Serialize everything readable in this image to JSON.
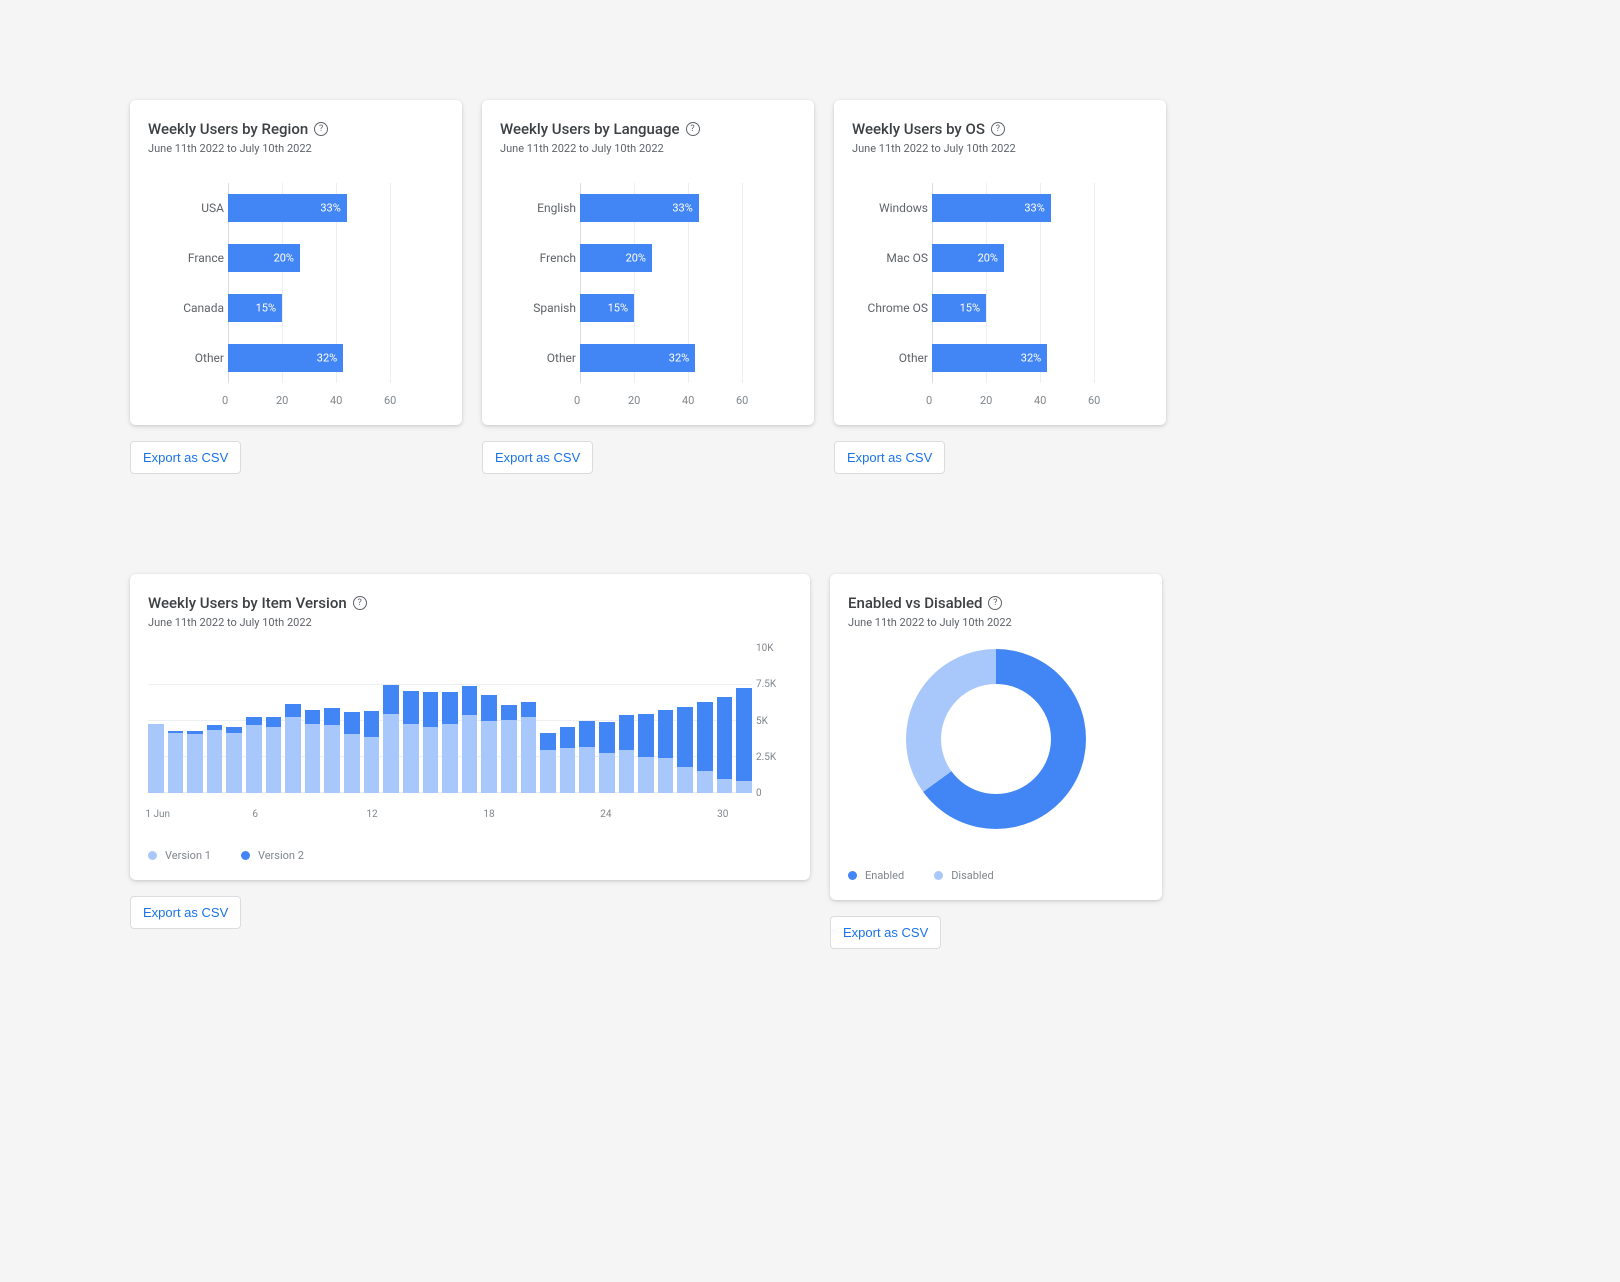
{
  "common": {
    "date_range": "June 11th 2022 to July 10th 2022",
    "export_label": "Export as CSV"
  },
  "cards": {
    "region": {
      "title": "Weekly Users by Region"
    },
    "language": {
      "title": "Weekly Users by Language"
    },
    "os": {
      "title": "Weekly Users by OS"
    },
    "version": {
      "title": "Weekly Users by Item Version",
      "legend": {
        "v1": "Version 1",
        "v2": "Version 2"
      }
    },
    "enabled": {
      "title": "Enabled vs Disabled",
      "legend": {
        "enabled": "Enabled",
        "disabled": "Disabled"
      }
    }
  },
  "chart_data": [
    {
      "id": "region",
      "type": "bar",
      "orientation": "horizontal",
      "title": "Weekly Users by Region",
      "categories": [
        "USA",
        "France",
        "Canada",
        "Other"
      ],
      "values": [
        33,
        20,
        15,
        32
      ],
      "value_suffix": "%",
      "x_ticks": [
        0,
        20,
        40,
        60
      ],
      "xlim": [
        0,
        60
      ]
    },
    {
      "id": "language",
      "type": "bar",
      "orientation": "horizontal",
      "title": "Weekly Users by Language",
      "categories": [
        "English",
        "French",
        "Spanish",
        "Other"
      ],
      "values": [
        33,
        20,
        15,
        32
      ],
      "value_suffix": "%",
      "x_ticks": [
        0,
        20,
        40,
        60
      ],
      "xlim": [
        0,
        60
      ]
    },
    {
      "id": "os",
      "type": "bar",
      "orientation": "horizontal",
      "title": "Weekly Users by OS",
      "categories": [
        "Windows",
        "Mac OS",
        "Chrome OS",
        "Other"
      ],
      "values": [
        33,
        20,
        15,
        32
      ],
      "value_suffix": "%",
      "x_ticks": [
        0,
        20,
        40,
        60
      ],
      "xlim": [
        0,
        60
      ]
    },
    {
      "id": "version",
      "type": "bar",
      "orientation": "vertical-stacked",
      "title": "Weekly Users by Item Version",
      "x": [
        1,
        2,
        3,
        4,
        5,
        6,
        7,
        8,
        9,
        10,
        11,
        12,
        13,
        14,
        15,
        16,
        17,
        18,
        19,
        20,
        21,
        22,
        23,
        24,
        25,
        26,
        27,
        28,
        29,
        30,
        31
      ],
      "x_tick_labels": {
        "1": "1 Jun",
        "6": "6",
        "12": "12",
        "18": "18",
        "24": "24",
        "30": "30"
      },
      "series": [
        {
          "name": "Version 1",
          "color": "#a8c7fa",
          "values": [
            4800,
            4200,
            4100,
            4400,
            4200,
            4700,
            4600,
            5300,
            4800,
            4700,
            4100,
            3900,
            5500,
            4800,
            4600,
            4800,
            5400,
            5000,
            5100,
            5300,
            3000,
            3100,
            3200,
            2800,
            3000,
            2500,
            2400,
            1800,
            1500,
            1000,
            800
          ]
        },
        {
          "name": "Version 2",
          "color": "#4285f4",
          "values": [
            0,
            100,
            200,
            300,
            400,
            600,
            700,
            900,
            1000,
            1200,
            1500,
            1800,
            2000,
            2300,
            2400,
            2200,
            2000,
            1800,
            1000,
            1000,
            1200,
            1500,
            1800,
            2100,
            2400,
            3000,
            3400,
            4200,
            4800,
            5700,
            6500
          ]
        }
      ],
      "y_ticks": [
        0,
        2500,
        5000,
        7500,
        10000
      ],
      "y_tick_labels": [
        "0",
        "2.5K",
        "5K",
        "7.5K",
        "10K"
      ],
      "ylim": [
        0,
        10000
      ]
    },
    {
      "id": "enabled",
      "type": "pie",
      "subtype": "donut",
      "title": "Enabled vs Disabled",
      "categories": [
        "Enabled",
        "Disabled"
      ],
      "values": [
        65,
        35
      ],
      "colors": [
        "#4285f4",
        "#a8c7fa"
      ]
    }
  ]
}
